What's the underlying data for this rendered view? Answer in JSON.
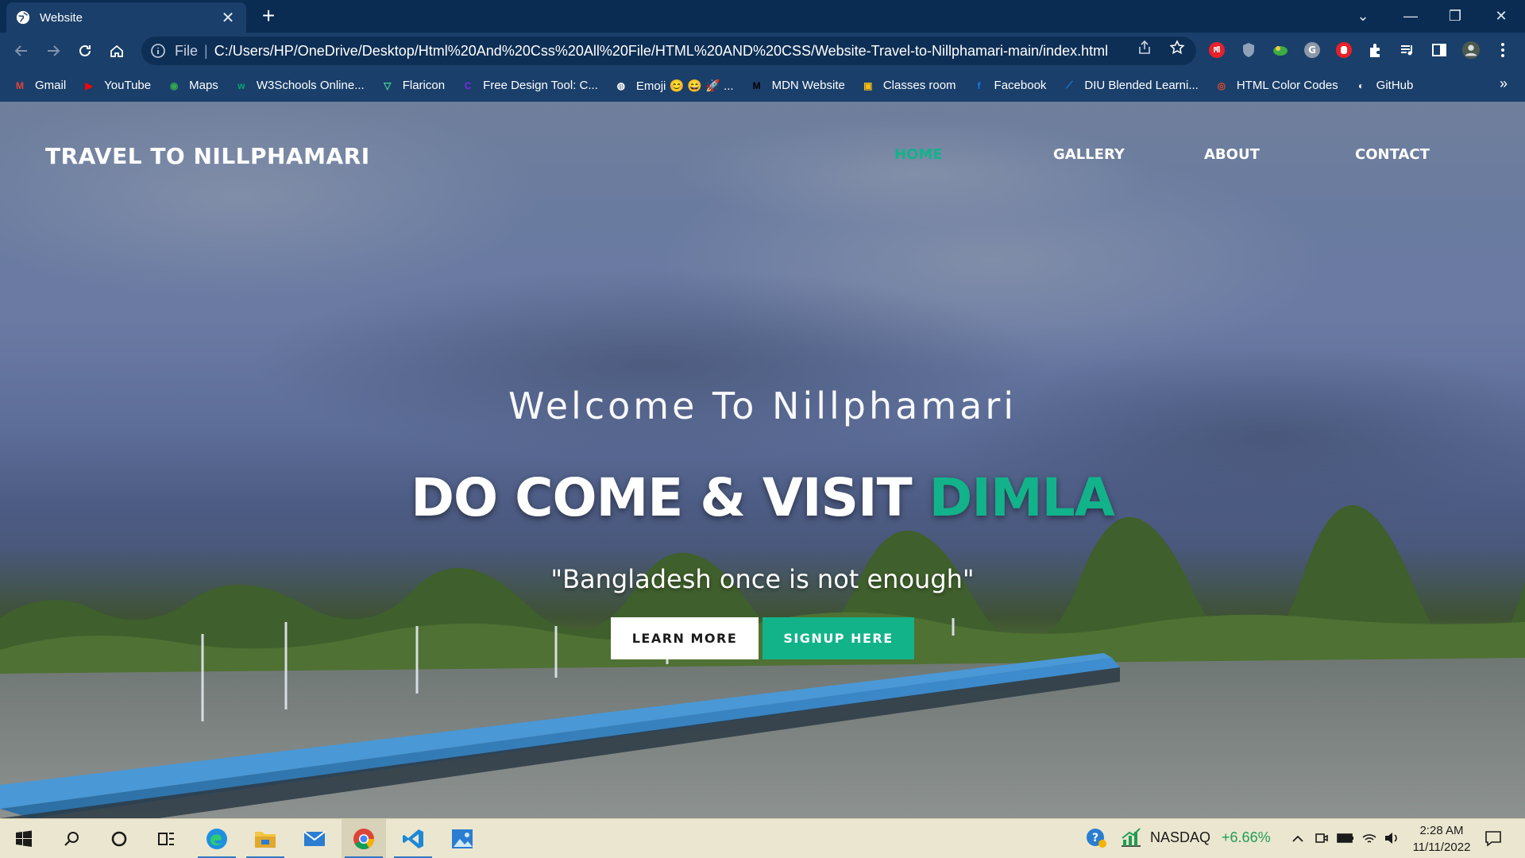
{
  "browser": {
    "tab": {
      "title": "Website",
      "close": "✕"
    },
    "new_tab": "+",
    "window_controls": {
      "list": "⌄",
      "minimize": "—",
      "restore": "❐",
      "close": "✕"
    },
    "omnibox": {
      "scheme": "File",
      "separator": "|",
      "url": "C:/Users/HP/OneDrive/Desktop/Html%20And%20Css%20All%20File/HTML%20AND%20CSS/Website-Travel-to-Nillphamari-main/index.html"
    },
    "bookmarks": [
      {
        "label": "Gmail",
        "icon": "gmail-icon",
        "color": "#ea4335",
        "glyph": "M"
      },
      {
        "label": "YouTube",
        "icon": "youtube-icon",
        "color": "#ff0000",
        "glyph": "▶"
      },
      {
        "label": "Maps",
        "icon": "maps-icon",
        "color": "#34a853",
        "glyph": "◉"
      },
      {
        "label": "W3Schools Online...",
        "icon": "w3schools-icon",
        "color": "#04aa6d",
        "glyph": "w"
      },
      {
        "label": "Flaricon",
        "icon": "flaticon-icon",
        "color": "#4ad295",
        "glyph": "▽"
      },
      {
        "label": "Free Design Tool: C...",
        "icon": "canva-icon",
        "color": "#7d2ae8",
        "glyph": "C"
      },
      {
        "label": "Emoji 😊 😄 🚀 ...",
        "icon": "globe-icon",
        "color": "#ffffff",
        "glyph": "◍"
      },
      {
        "label": "MDN Website",
        "icon": "mdn-icon",
        "color": "#000000",
        "glyph": "M"
      },
      {
        "label": "Classes room",
        "icon": "classroom-icon",
        "color": "#f9bc15",
        "glyph": "▣"
      },
      {
        "label": "Facebook",
        "icon": "facebook-icon",
        "color": "#1877f2",
        "glyph": "f"
      },
      {
        "label": "DIU Blended Learni...",
        "icon": "diu-icon",
        "color": "#1f7ae0",
        "glyph": "⟋"
      },
      {
        "label": "HTML Color Codes",
        "icon": "htmlcolor-icon",
        "color": "#e44d26",
        "glyph": "◎"
      },
      {
        "label": "GitHub",
        "icon": "github-icon",
        "color": "#ffffff",
        "glyph": "◐"
      }
    ],
    "bookmarks_more": "»"
  },
  "site": {
    "logo": "TRAVEL TO NILLPHAMARI",
    "nav": [
      {
        "label": "HOME",
        "active": true
      },
      {
        "label": "GALLERY",
        "active": false
      },
      {
        "label": "ABOUT",
        "active": false
      },
      {
        "label": "CONTACT",
        "active": false
      }
    ],
    "hero": {
      "welcome": "Welcome To Nillphamari",
      "title_main": "DO COME & VISIT ",
      "title_accent": "DIMLA",
      "quote": "\"Bangladesh once is not enough\"",
      "learn_more": "LEARN MORE",
      "signup": "SIGNUP HERE"
    },
    "accent_color": "#12b38a"
  },
  "taskbar": {
    "stock": {
      "symbol": "NASDAQ",
      "change": "+6.66%"
    },
    "clock": {
      "time": "2:28 AM",
      "date": "11/11/2022"
    }
  }
}
